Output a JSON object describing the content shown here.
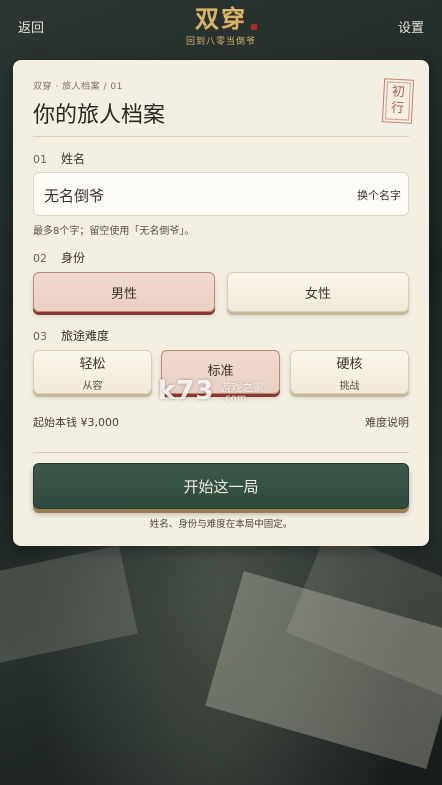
{
  "topbar": {
    "back_label": "返回",
    "settings_label": "设置",
    "logo_title": "双穿",
    "logo_subtitle": "回到八零当倒爷"
  },
  "card": {
    "breadcrumb": "双穿 · 旅人档案 / 01",
    "title": "你的旅人档案",
    "stamp_text": "初行"
  },
  "name_section": {
    "number": "01",
    "label": "姓名",
    "value": "无名倒爷",
    "change_label": "换个名字",
    "hint": "最多8个字；留空使用「无名倒爷」。"
  },
  "identity_section": {
    "number": "02",
    "label": "身份",
    "options": [
      {
        "label": "男性",
        "selected": true
      },
      {
        "label": "女性",
        "selected": false
      }
    ]
  },
  "difficulty_section": {
    "number": "03",
    "label": "旅途难度",
    "options": [
      {
        "label": "轻松",
        "desc": "从容",
        "selected": false
      },
      {
        "label": "标准",
        "desc": "",
        "selected": true
      },
      {
        "label": "硬核",
        "desc": "挑战",
        "selected": false
      }
    ]
  },
  "money": {
    "label": "起始本钱 ¥3,000",
    "help_link": "难度说明"
  },
  "start_button": "开始这一局",
  "note": "姓名、身份与难度在本局中固定。",
  "watermark": {
    "big": "k73",
    "small": "游戏之家",
    "domain": ".com"
  },
  "colors": {
    "accent_green": "#2f4a3e",
    "selected_fill": "#ead0c4",
    "logo_gold": "#d8b46a"
  }
}
